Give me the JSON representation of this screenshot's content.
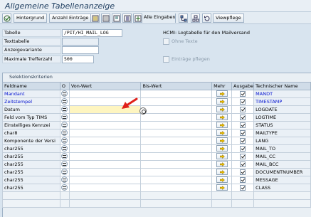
{
  "title": "Allgemeine Tabellenanzeige",
  "toolbar": {
    "hintergrund": "Hintergrund",
    "anzahl": "Anzahl Einträge",
    "alle_eingaben": "Alle Eingaben",
    "viewpflege": "Viewpflege"
  },
  "form": {
    "tabelle_label": "Tabelle",
    "tabelle_value": "/PIT/HI_MAIL_LOG",
    "tabelle_desc": "HCMI: Logtabelle für den Mailversand",
    "texttabelle_label": "Texttabelle",
    "texttabelle_value": "",
    "ohne_texte": "Ohne Texte",
    "anzeigevariante_label": "Anzeigevariante",
    "anzeigevariante_value": "",
    "max_label": "Maximale Trefferzahl",
    "max_value": "500",
    "eintraege_pflegen": "Einträge pflegen"
  },
  "section": {
    "title": "Selektionskriterien"
  },
  "grid": {
    "headers": {
      "feldname": "Feldname",
      "o": "O",
      "von": "Von-Wert",
      "bis": "Bis-Wert",
      "mehr": "Mehr",
      "ausgabe": "Ausgabe",
      "tech": "Technischer Name"
    },
    "rows": [
      {
        "feldname": "Mandant",
        "tech": "MANDT"
      },
      {
        "feldname": "Zeitstempel",
        "tech": "TIMESTAMP"
      },
      {
        "feldname": "Datum",
        "tech": "LOGDATE"
      },
      {
        "feldname": "Feld vom Typ TIMS",
        "tech": "LOGTIME"
      },
      {
        "feldname": "Einstelliges Kennzei",
        "tech": "STATUS"
      },
      {
        "feldname": "char8",
        "tech": "MAILTYPE"
      },
      {
        "feldname": "Komponente der Versi",
        "tech": "LANG"
      },
      {
        "feldname": "char255",
        "tech": "MAIL_TO"
      },
      {
        "feldname": "char255",
        "tech": "MAIL_CC"
      },
      {
        "feldname": "char255",
        "tech": "MAIL_BCC"
      },
      {
        "feldname": "char255",
        "tech": "DOCUMENTNUMBER"
      },
      {
        "feldname": "char255",
        "tech": "MESSAGE"
      },
      {
        "feldname": "char255",
        "tech": "CLASS"
      }
    ]
  },
  "colors": {
    "key_field_blue": "#0010d0",
    "highlight_yellow": "#fef5c0",
    "pointer_red": "#e0201a"
  }
}
